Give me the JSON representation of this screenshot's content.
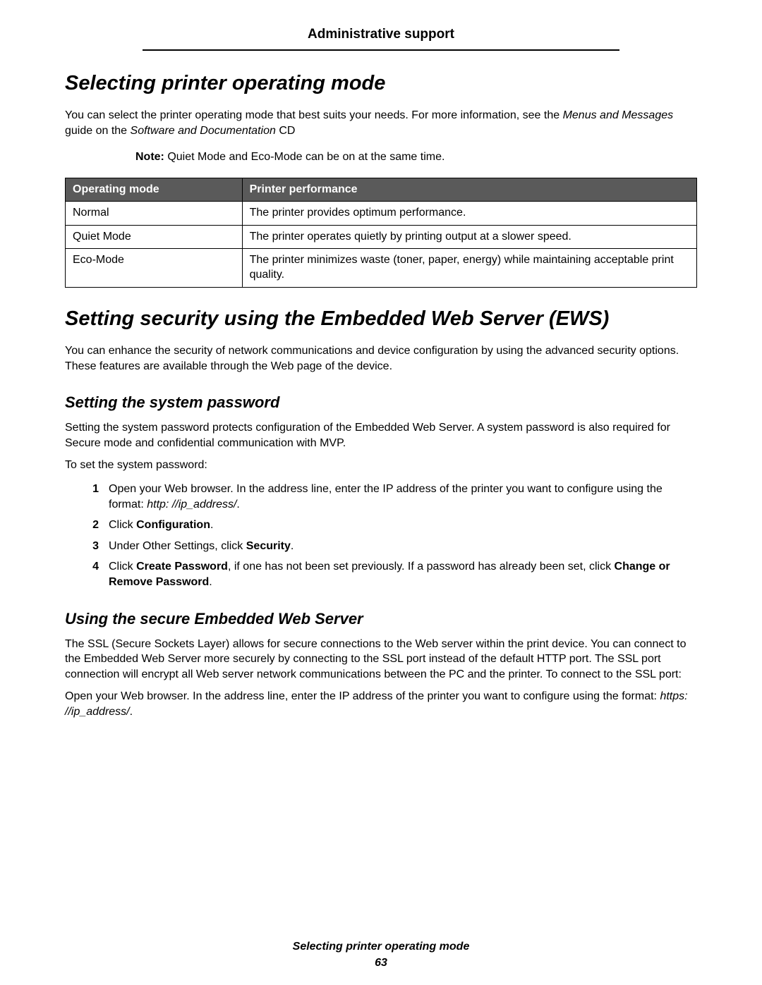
{
  "header": {
    "section_title": "Administrative support"
  },
  "section1": {
    "heading": "Selecting printer operating mode",
    "intro_part1": "You can select the printer operating mode that best suits your needs. For more information, see the ",
    "intro_ital1": "Menus and Messages",
    "intro_part2": " guide on the ",
    "intro_ital2": "Software and Documentation",
    "intro_part3": " CD",
    "note_label": "Note:",
    "note_text": " Quiet Mode and Eco-Mode can be on at the same time.",
    "table": {
      "col1": "Operating mode",
      "col2": "Printer performance",
      "rows": [
        {
          "mode": "Normal",
          "perf": "The printer provides optimum performance."
        },
        {
          "mode": "Quiet Mode",
          "perf": "The printer operates quietly by printing output at a slower speed."
        },
        {
          "mode": "Eco-Mode",
          "perf": "The printer minimizes waste (toner, paper, energy) while maintaining acceptable print quality."
        }
      ]
    }
  },
  "section2": {
    "heading": "Setting security using the Embedded Web Server (EWS)",
    "intro": "You can enhance the security of network communications and device configuration by using the advanced security options. These features are available through the Web page of the device.",
    "sub1": {
      "heading": "Setting the system password",
      "p1": "Setting the system password protects configuration of the Embedded Web Server. A system password is also required for Secure mode and confidential communication with MVP.",
      "p2": "To set the system password:",
      "steps": {
        "s1_a": "Open your Web browser. In the address line, enter the IP address of the printer you want to configure using the format: ",
        "s1_b": "http: //ip_address/",
        "s1_c": ".",
        "s2_a": "Click ",
        "s2_b": "Configuration",
        "s2_c": ".",
        "s3_a": "Under Other Settings, click ",
        "s3_b": "Security",
        "s3_c": ".",
        "s4_a": "Click ",
        "s4_b": "Create Password",
        "s4_c": ", if one has not been set previously. If a password has already been set, click ",
        "s4_d": "Change or Remove Password",
        "s4_e": "."
      }
    },
    "sub2": {
      "heading": "Using the secure Embedded Web Server",
      "p1": "The SSL (Secure Sockets Layer) allows for secure connections to the Web server within the print device. You can connect to the Embedded Web Server more securely by connecting to the SSL port instead of the default HTTP port. The SSL port connection will encrypt all Web server network communications between the PC and the printer. To connect to the SSL port:",
      "p2_a": "Open your Web browser. In the address line, enter the IP address of the printer you want to configure using the format: ",
      "p2_b": "https: //ip_address/",
      "p2_c": "."
    }
  },
  "footer": {
    "line1": "Selecting printer operating mode",
    "line2": "63"
  }
}
